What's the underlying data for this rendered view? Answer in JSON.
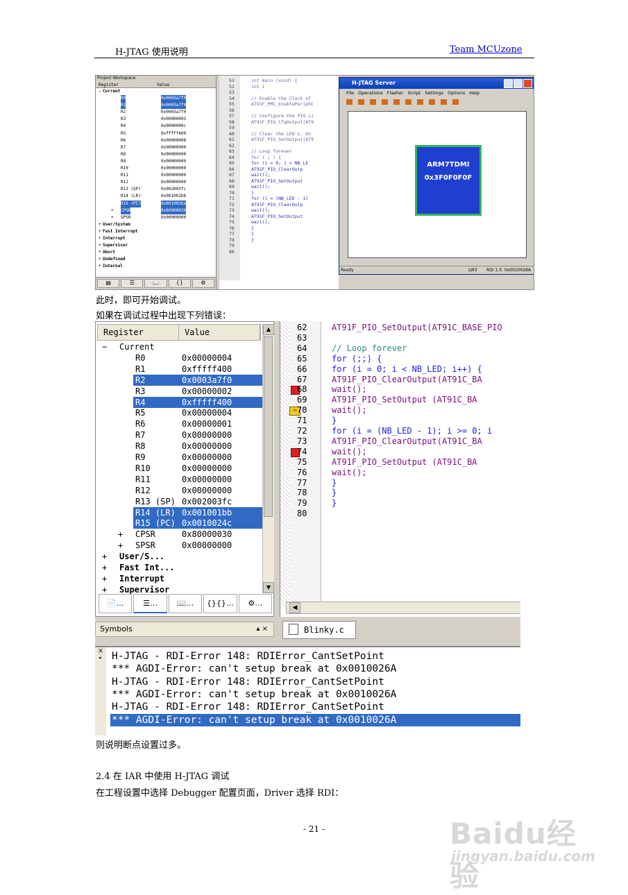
{
  "header": {
    "left": "H-JTAG 使用说明",
    "right": "Team MCUzone"
  },
  "shot1": {
    "workspace_title": "Project Workspace",
    "col_register": "Register",
    "col_value": "Value",
    "rows": [
      {
        "g": "−",
        "name": "Current",
        "value": "",
        "type": "top"
      },
      {
        "name": "R0",
        "value": "0x0003a7f0",
        "sel": true
      },
      {
        "name": "R1",
        "value": "0x0003a7f0",
        "sel": true
      },
      {
        "name": "R2",
        "value": "0x0003a7f0"
      },
      {
        "name": "R3",
        "value": "0x00000003"
      },
      {
        "name": "R4",
        "value": "0x0000000c"
      },
      {
        "name": "R5",
        "value": "0xfffff400"
      },
      {
        "name": "R6",
        "value": "0x00000008"
      },
      {
        "name": "R7",
        "value": "0x00000000"
      },
      {
        "name": "R8",
        "value": "0x00000000"
      },
      {
        "name": "R9",
        "value": "0x00000000"
      },
      {
        "name": "R10",
        "value": "0x00000000"
      },
      {
        "name": "R11",
        "value": "0x00000000"
      },
      {
        "name": "R12",
        "value": "0x00000000"
      },
      {
        "name": "R13 (SP)",
        "value": "0x002003fc"
      },
      {
        "name": "R14 (LR)",
        "value": "0x001001bb"
      },
      {
        "name": "R15 (PC)",
        "value": "0x0010026a",
        "sel": true
      },
      {
        "g2": "+",
        "name": "CPSR",
        "value": "0x60000030",
        "sel": true
      },
      {
        "g2": "+",
        "name": "SPSR",
        "value": "0x00000000"
      },
      {
        "g": "+",
        "name": "User/System",
        "value": "",
        "type": "top"
      },
      {
        "g": "+",
        "name": "Fast Interrupt",
        "value": "",
        "type": "top"
      },
      {
        "g": "+",
        "name": "Interrupt",
        "value": "",
        "type": "top"
      },
      {
        "g": "+",
        "name": "Supervisor",
        "value": "",
        "type": "top"
      },
      {
        "g": "+",
        "name": "Abort",
        "value": "",
        "type": "top"
      },
      {
        "g": "+",
        "name": "Undefined",
        "value": "",
        "type": "top"
      },
      {
        "g": "+",
        "name": "Internal",
        "value": "",
        "type": "top"
      }
    ],
    "line_numbers": [
      "51",
      "52",
      "53",
      "54",
      "55",
      "56",
      "57",
      "58",
      "59",
      "60",
      "61",
      "62",
      "63",
      "64",
      "65",
      "66",
      "67",
      "68",
      "69",
      "70",
      "71",
      "72",
      "73",
      "74",
      "75",
      "76",
      "77",
      "78",
      "79",
      "80"
    ],
    "code": [
      "int main (void) {",
      "  int i",
      "",
      "  // Enable the Clock of",
      "  AT91F_PMC_EnablePeriphC",
      "",
      "  // Configure the PIO Li",
      "  AT91F_PIO_CfgOutput(AT9",
      "",
      "  // Clear the LED's. On",
      "  AT91F_PIO_SetOutput(AT9",
      "",
      "  // Loop forever",
      "  for ( ; ) {",
      "    for (i = 0; i < NB_LE",
      "      AT91F_PIO_ClearOutp",
      "      wait();",
      "      AT91F_PIO_SetOutput",
      "      wait();",
      "    }",
      "    for (i = (NB_LED - 1)",
      "      AT91F_PIO_ClearOutp",
      "      wait();",
      "      AT91F_PIO_SetOutput",
      "      wait();",
      "    }",
      "  }",
      "}",
      "",
      ""
    ],
    "hjtag": {
      "title": "H-JTAG Server",
      "menu": "File Operations Flasher Script Settings Options Help",
      "chip_line1": "ARM7TDMI",
      "chip_line2": "0x3F0F0F0F",
      "status_left": "Ready",
      "status_mid": "LW3",
      "status_right": "RDI 1.5: 0x0010026A"
    }
  },
  "text1": "此时，即可开始调试。",
  "text2": "如果在调试过程中出现下列错误：",
  "shot2": {
    "col_register": "Register",
    "col_value": "Value",
    "rows": [
      {
        "g": "−",
        "name": "Current",
        "value": "",
        "type": "top"
      },
      {
        "name": "R0",
        "value": "0x00000004"
      },
      {
        "name": "R1",
        "value": "0xfffff400"
      },
      {
        "name": "R2",
        "value": "0x0003a7f0",
        "sel": true
      },
      {
        "name": "R3",
        "value": "0x00000002"
      },
      {
        "name": "R4",
        "value": "0xfffff400",
        "sel": true
      },
      {
        "name": "R5",
        "value": "0x00000004"
      },
      {
        "name": "R6",
        "value": "0x00000001"
      },
      {
        "name": "R7",
        "value": "0x00000000"
      },
      {
        "name": "R8",
        "value": "0x00000000"
      },
      {
        "name": "R9",
        "value": "0x00000000"
      },
      {
        "name": "R10",
        "value": "0x00000000"
      },
      {
        "name": "R11",
        "value": "0x00000000"
      },
      {
        "name": "R12",
        "value": "0x00000000"
      },
      {
        "name": "R13 (SP)",
        "value": "0x002003fc"
      },
      {
        "name": "R14 (LR)",
        "value": "0x001001bb",
        "sel": true
      },
      {
        "name": "R15 (PC)",
        "value": "0x0010024c",
        "sel": true
      },
      {
        "g2": "+",
        "name": "CPSR",
        "value": "0x80000030"
      },
      {
        "g2": "+",
        "name": "SPSR",
        "value": "0x00000000"
      },
      {
        "g": "+",
        "name": "User/S...",
        "value": "",
        "type": "top"
      },
      {
        "g": "+",
        "name": "Fast Int...",
        "value": "",
        "type": "top"
      },
      {
        "g": "+",
        "name": "Interrupt",
        "value": "",
        "type": "top"
      },
      {
        "g": "+",
        "name": "Supervisor",
        "value": "",
        "type": "top"
      }
    ],
    "tabs": [
      "…",
      "…",
      "…",
      "{}…",
      "…"
    ],
    "symbols_label": "Symbols",
    "symbols_ctl": "▴ ×",
    "file_tab": "Blinky.c",
    "code_lines": [
      {
        "n": "62",
        "t": "  AT91F_PIO_SetOutput(AT91C_BASE_PIO",
        "c": "fn"
      },
      {
        "n": "63",
        "t": "",
        "c": "fn"
      },
      {
        "n": "64",
        "t": "  // Loop forever",
        "c": "cm"
      },
      {
        "n": "65",
        "t": "  for (;;) {",
        "c": "kw"
      },
      {
        "n": "66",
        "t": "    for (i = 0; i < NB_LED; i++) {",
        "c": "kw"
      },
      {
        "n": "67",
        "t": "      AT91F_PIO_ClearOutput(AT91C_BA",
        "c": "fn"
      },
      {
        "n": "68",
        "t": "      wait();",
        "c": "fn",
        "bp": true
      },
      {
        "n": "69",
        "t": "      AT91F_PIO_SetOutput  (AT91C_BA",
        "c": "fn"
      },
      {
        "n": "70",
        "t": "      wait();",
        "c": "fn",
        "pc": true
      },
      {
        "n": "71",
        "t": "    }",
        "c": "kw"
      },
      {
        "n": "72",
        "t": "    for (i = (NB_LED - 1); i >= 0; i",
        "c": "kw"
      },
      {
        "n": "73",
        "t": "      AT91F_PIO_ClearOutput(AT91C_BA",
        "c": "fn"
      },
      {
        "n": "74",
        "t": "      wait();",
        "c": "fn",
        "bp": true
      },
      {
        "n": "75",
        "t": "      AT91F_PIO_SetOutput  (AT91C_BA",
        "c": "fn"
      },
      {
        "n": "76",
        "t": "      wait();",
        "c": "fn"
      },
      {
        "n": "77",
        "t": "    }",
        "c": "kw"
      },
      {
        "n": "78",
        "t": "  }",
        "c": "kw"
      },
      {
        "n": "79",
        "t": "}",
        "c": "kw"
      },
      {
        "n": "80",
        "t": "",
        "c": "fn"
      }
    ],
    "output": [
      "H-JTAG - RDI-Error 148: RDIError_CantSetPoint",
      "*** AGDI-Error: can't setup break at 0x0010026A",
      "H-JTAG - RDI-Error 148: RDIError_CantSetPoint",
      "*** AGDI-Error: can't setup break at 0x0010026A",
      "H-JTAG - RDI-Error 148: RDIError_CantSetPoint",
      "*** AGDI-Error: can't setup break at 0x0010026A"
    ],
    "output_selected_index": 5
  },
  "text3": "则说明断点设置过多。",
  "section_title": "2.4   在 IAR 中使用 H-JTAG 调试",
  "text4": "在工程设置中选择 Debugger 配置页面，Driver 选择 RDI：",
  "page_number": "- 21 -",
  "watermark": {
    "big": "Baidu经验",
    "small": "jingyan.baidu.com"
  }
}
